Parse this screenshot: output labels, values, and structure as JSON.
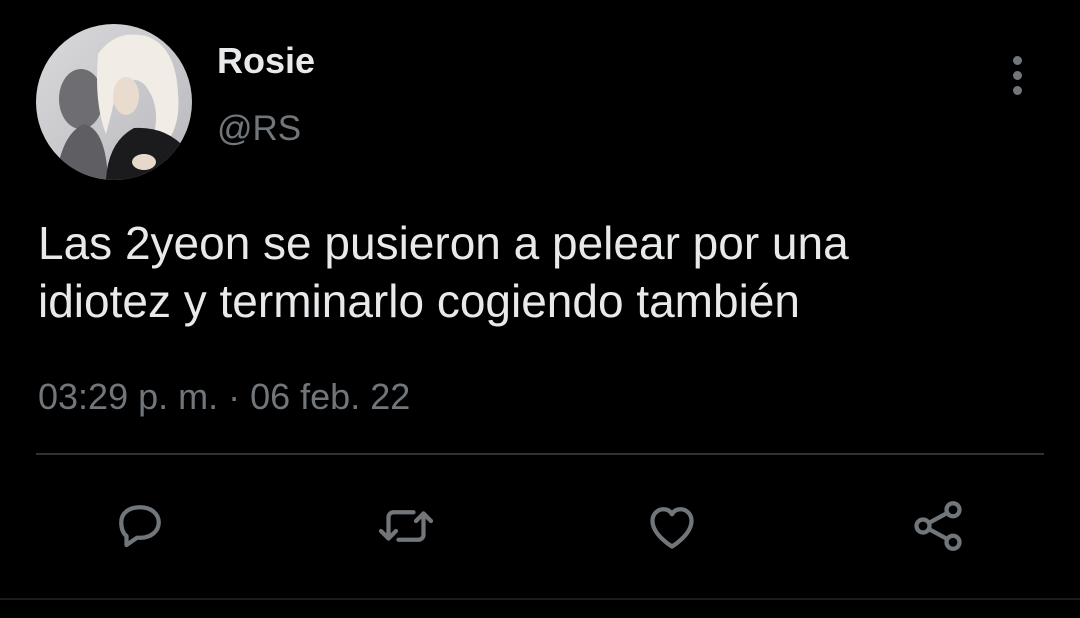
{
  "tweet": {
    "author": {
      "display_name": "Rosie",
      "handle": "@RS",
      "avatar_icon": "avatar-photo"
    },
    "text_lines": [
      "Las 2yeon se pusieron a pelear por una",
      "idiotez y terminarlo cogiendo también"
    ],
    "timestamp": "03:29 p. m. · 06 feb. 22"
  },
  "actions": {
    "reply_icon": "reply-icon",
    "retweet_icon": "retweet-icon",
    "like_icon": "heart-icon",
    "share_icon": "share-icon",
    "more_icon": "more-vertical-icon"
  },
  "colors": {
    "background": "#000000",
    "primary_text": "#e7e9ea",
    "secondary_text": "#71767b",
    "divider": "#2f3336"
  }
}
